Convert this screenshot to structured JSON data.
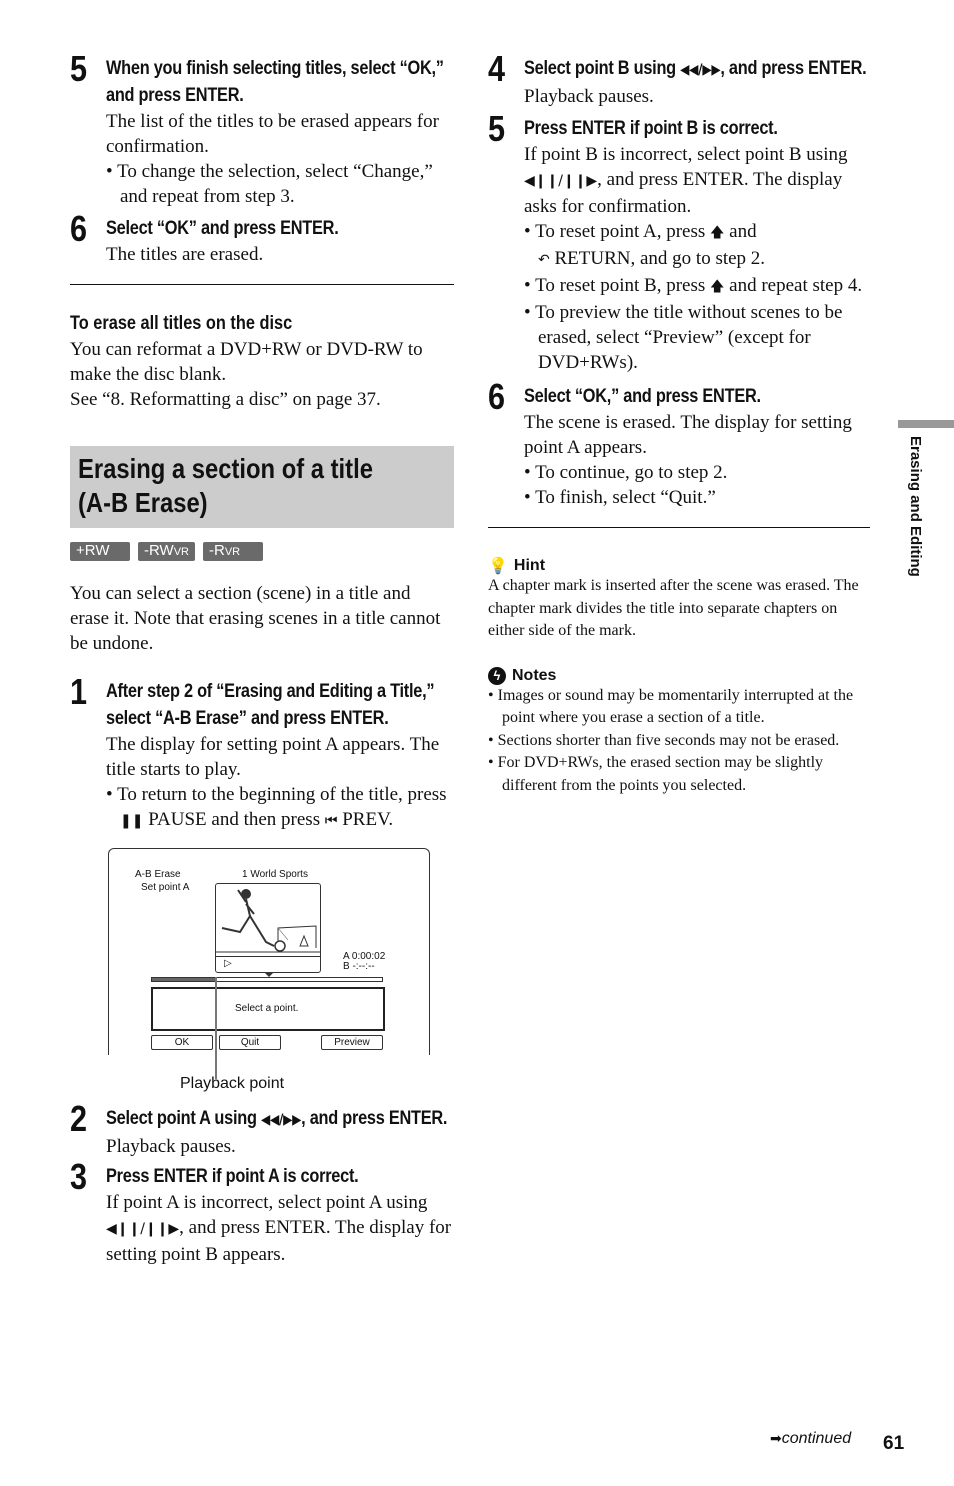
{
  "page": {
    "number": "61",
    "continued": "continued",
    "side_tab": "Erasing and Editing"
  },
  "left": {
    "step5": {
      "num": "5",
      "head": "When you finish selecting titles, select “OK,” and press ENTER.",
      "body": "The list of the titles to be erased appears for confirmation.",
      "bullets": [
        "To change the selection, select “Change,” and repeat from step 3."
      ]
    },
    "step6": {
      "num": "6",
      "head": "Select “OK” and press ENTER.",
      "body": "The titles are erased."
    },
    "erase_all": {
      "title": "To erase all titles on the disc",
      "lines": [
        "You can reformat a DVD+RW or DVD-RW to make the disc blank.",
        "See “8. Reformatting a disc” on page 37."
      ]
    },
    "section": {
      "title_line1": "Erasing a section of a title",
      "title_line2": "(A-B Erase)",
      "badges": [
        {
          "main": "+RW",
          "sub": ""
        },
        {
          "main": "-RW",
          "sub": "VR"
        },
        {
          "main": "-R",
          "sub": "VR"
        }
      ],
      "intro": "You can select a section (scene) in a title and erase it. Note that erasing scenes in a title cannot be undone."
    },
    "step1": {
      "num": "1",
      "head": "After step 2 of “Erasing and Editing a Title,” select “A-B Erase” and press ENTER.",
      "body": "The display for setting point A appears. The title starts to play.",
      "bullet_a": "To return to the beginning of the title, press",
      "pause_label": "PAUSE and then press",
      "prev_label": "PREV."
    },
    "screen": {
      "mode": "A-B Erase",
      "sub_mode": "Set point A",
      "title": "1 World Sports",
      "point_a": "A 0:00:02",
      "point_b": "B -:--:--",
      "message": "Select a point.",
      "buttons": [
        "OK",
        "Quit",
        "Preview"
      ],
      "progress_fraction": 0.28,
      "callout": "Playback point"
    },
    "step2": {
      "num": "2",
      "head_a": "Select point A using",
      "head_b": ", and press ENTER.",
      "body": "Playback pauses."
    },
    "step3": {
      "num": "3",
      "head": "Press ENTER if point A is correct.",
      "body_a": "If point A is incorrect, select point A using",
      "body_b": ", and press ENTER. The display for setting point B appears."
    }
  },
  "right": {
    "step4": {
      "num": "4",
      "head_a": "Select point B using",
      "head_b": ", and press ENTER.",
      "body": "Playback pauses."
    },
    "step5": {
      "num": "5",
      "head": "Press ENTER if point B is correct.",
      "body_a": "If point B is incorrect, select point B using",
      "body_b": ", and press ENTER. The display asks for confirmation.",
      "bullet1_a": "To reset point A, press",
      "bullet1_b": "and",
      "bullet1_c": "RETURN, and go to step 2.",
      "bullet2_a": "To reset point B, press",
      "bullet2_b": "and repeat step 4.",
      "bullet3": "To preview the title without scenes to be erased, select “Preview” (except for DVD+RWs)."
    },
    "step6": {
      "num": "6",
      "head": "Select “OK,” and press ENTER.",
      "body": "The scene is erased. The display for setting point A appears.",
      "bullets": [
        "To continue, go to step 2.",
        "To finish, select “Quit.”"
      ]
    },
    "hint": {
      "title": "Hint",
      "body": "A chapter mark is inserted after the scene was erased. The chapter mark divides the title into separate chapters on either side of the mark."
    },
    "notes": {
      "title": "Notes",
      "items": [
        "Images or sound may be momentarily interrupted at the point where you erase a section of a title.",
        "Sections shorter than five seconds may not be erased.",
        "For DVD+RWs, the erased section may be slightly different from the points you selected."
      ]
    }
  },
  "colors": {
    "banner": "#cccccc",
    "badge": "#6a6a6a",
    "side_tab_bar": "#999999"
  }
}
